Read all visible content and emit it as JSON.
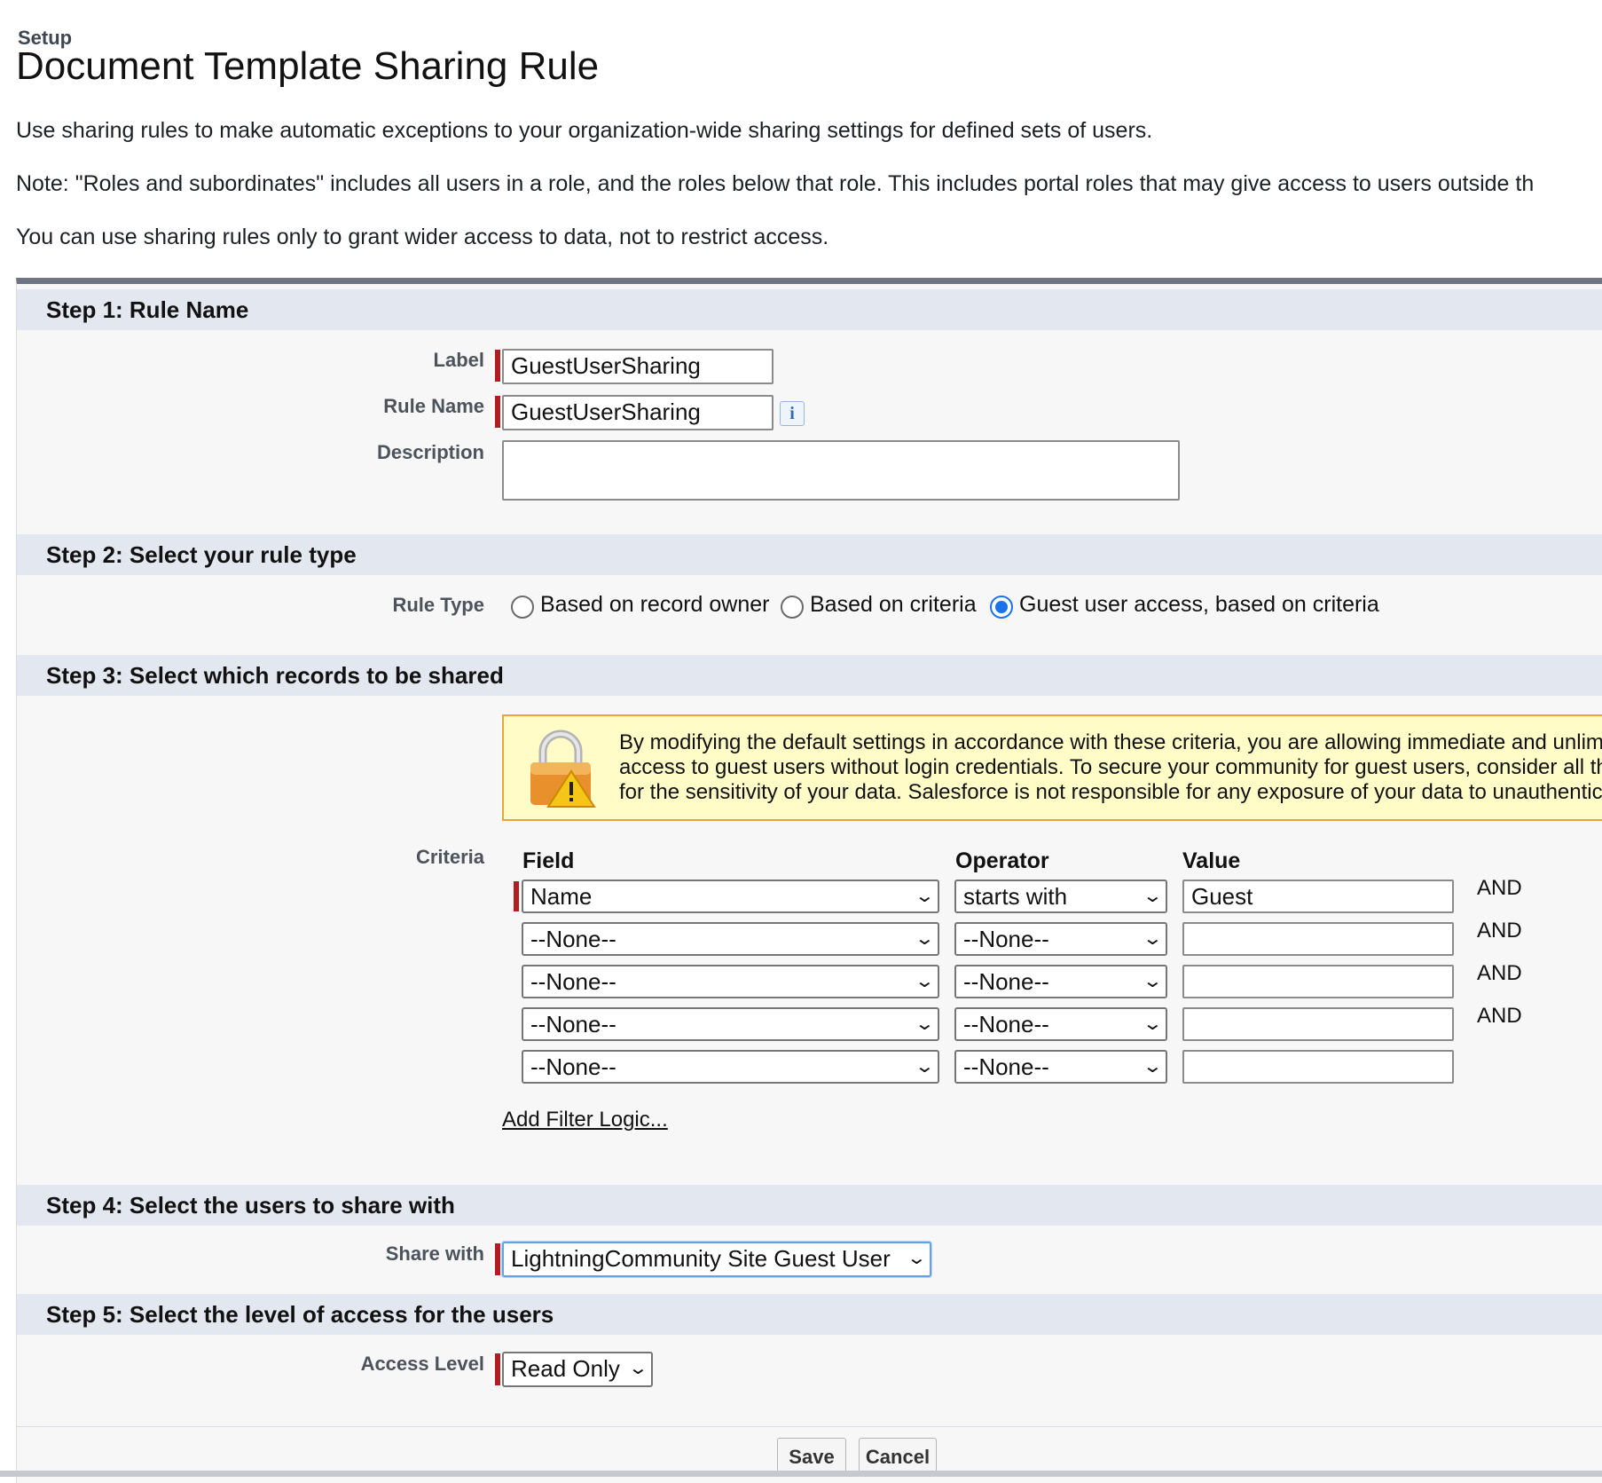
{
  "header": {
    "breadcrumb": "Setup",
    "title": "Document Template Sharing Rule"
  },
  "intro": {
    "line1": "Use sharing rules to make automatic exceptions to your organization-wide sharing settings for defined sets of users.",
    "line2": "Note: \"Roles and subordinates\" includes all users in a role, and the roles below that role. This includes portal roles that may give access to users outside th",
    "line3": "You can use sharing rules only to grant wider access to data, not to restrict access."
  },
  "step1": {
    "title": "Step 1: Rule Name",
    "label_label": "Label",
    "label_value": "GuestUserSharing",
    "rule_name_label": "Rule Name",
    "rule_name_value": "GuestUserSharing",
    "info_glyph": "i",
    "description_label": "Description",
    "description_value": ""
  },
  "step2": {
    "title": "Step 2: Select your rule type",
    "rule_type_label": "Rule Type",
    "options": [
      {
        "label": "Based on record owner",
        "checked": false
      },
      {
        "label": "Based on criteria",
        "checked": false
      },
      {
        "label": "Guest user access, based on criteria",
        "checked": true
      }
    ]
  },
  "step3": {
    "title": "Step 3: Select which records to be shared",
    "warning": {
      "line1": "By modifying the default settings in accordance with these criteria, you are allowing immediate and unlim",
      "line2": "access to guest users without login credentials. To secure your community for guest users, consider all th",
      "line3": "for the sensitivity of your data. Salesforce is not responsible for any exposure of your data to unauthentic"
    },
    "criteria_label": "Criteria",
    "col_field": "Field",
    "col_operator": "Operator",
    "col_value": "Value",
    "rows": [
      {
        "field": "Name",
        "operator": "starts with",
        "value": "Guest",
        "conj": "AND"
      },
      {
        "field": "--None--",
        "operator": "--None--",
        "value": "",
        "conj": "AND"
      },
      {
        "field": "--None--",
        "operator": "--None--",
        "value": "",
        "conj": "AND"
      },
      {
        "field": "--None--",
        "operator": "--None--",
        "value": "",
        "conj": "AND"
      },
      {
        "field": "--None--",
        "operator": "--None--",
        "value": "",
        "conj": ""
      }
    ],
    "filter_link": "Add Filter Logic..."
  },
  "step4": {
    "title": "Step 4: Select the users to share with",
    "share_with_label": "Share with",
    "share_with_value": "LightningCommunity Site Guest User"
  },
  "step5": {
    "title": "Step 5: Select the level of access for the users",
    "access_level_label": "Access Level",
    "access_level_value": "Read Only"
  },
  "buttons": {
    "save": "Save",
    "cancel": "Cancel"
  },
  "colors": {
    "required_bar": "#b11e22",
    "step_header_bg": "#e3e7ef",
    "warning_bg": "#fffcc7",
    "radio_checked": "#1a73e8"
  },
  "icons": {
    "info": "info-icon",
    "warning_lock": "lock-warning-icon",
    "chevron": "chevron-down-icon"
  }
}
